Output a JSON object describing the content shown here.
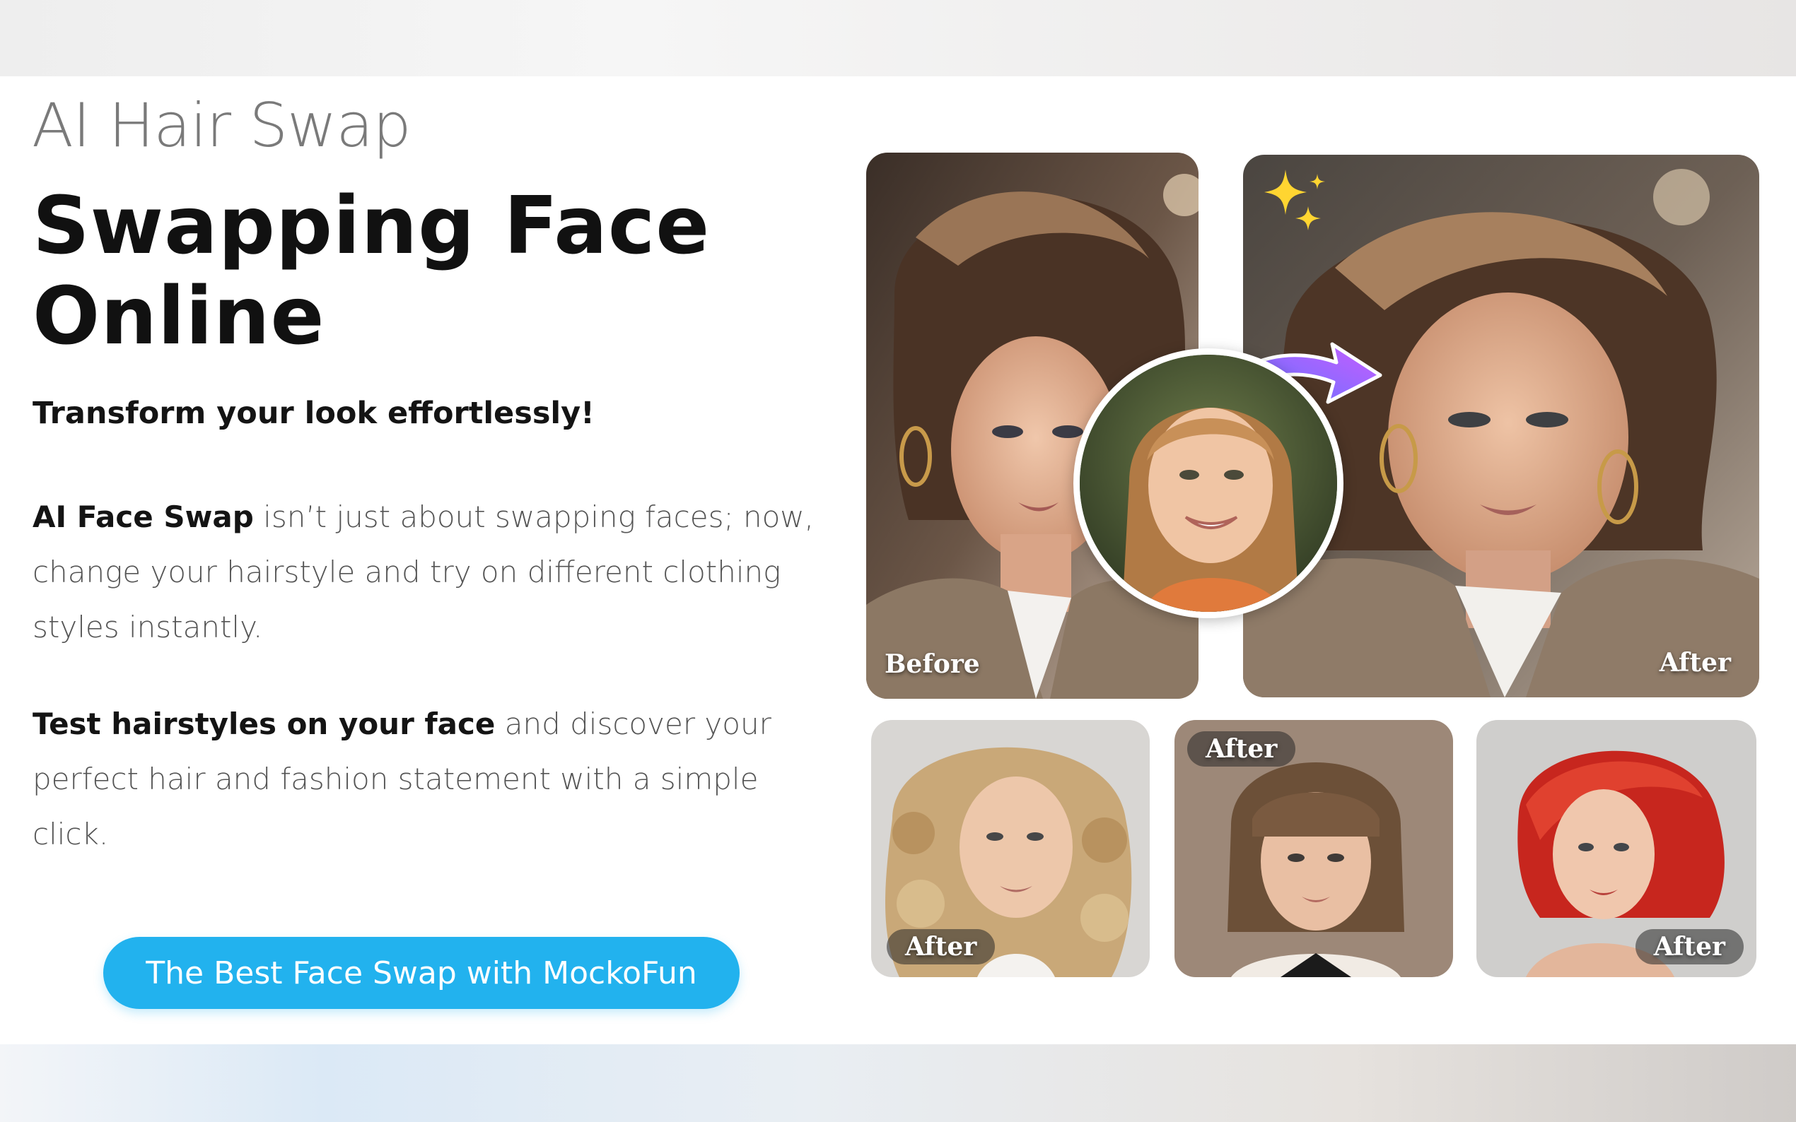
{
  "hero": {
    "eyebrow": "AI Hair Swap",
    "headline_line1": "Swapping Face",
    "headline_line2": "Online",
    "tagline": "Transform your look effortlessly!",
    "para1_bold": "AI Face Swap",
    "para1_rest": " isn’t just about swapping faces; now, change your hairstyle and try on different clothing styles instantly.",
    "para2_bold": "Test hairstyles on your face",
    "para2_rest": " and discover your perfect hair and fashion statement with a simple click.",
    "cta_label": "The Best Face Swap with MockoFun"
  },
  "gallery": {
    "before_label": "Before",
    "after_main_label": "After",
    "after_curly_label": "After",
    "after_bob_label": "After",
    "after_red_label": "After",
    "icons": [
      "sparkle-icon",
      "curved-arrow-icon"
    ]
  },
  "colors": {
    "cta": "#22b2ee",
    "headline": "#111111",
    "body_text": "#555555",
    "arrow_start": "#3f7dff",
    "arrow_end": "#c85cff",
    "sparkle": "#ffd531"
  }
}
